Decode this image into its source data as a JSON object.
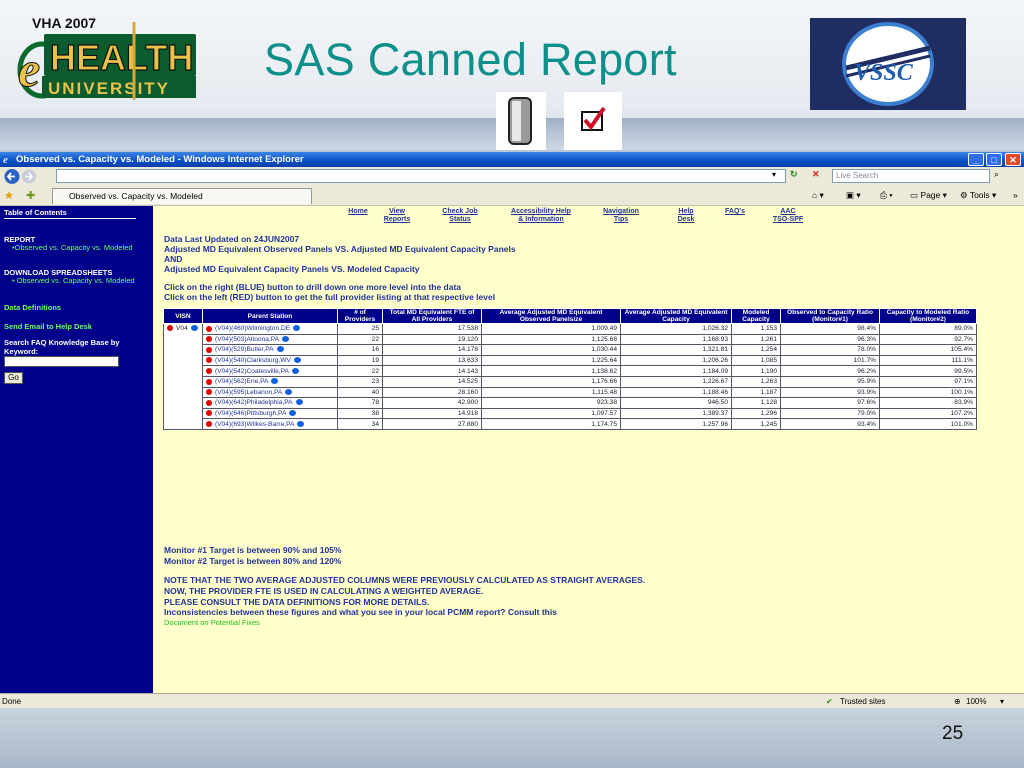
{
  "slide": {
    "title": "SAS Canned Report",
    "page_number": "25",
    "left_logo_text": "VHA 2007 eHEALTH UNIVERSITY",
    "right_logo_text": "VSSC"
  },
  "browser": {
    "window_title": "Observed vs. Capacity vs. Modeled - Windows Internet Explorer",
    "search_placeholder": "Live Search",
    "tab_label": "Observed vs. Capacity vs. Modeled",
    "toolbar": {
      "page": "Page",
      "tools": "Tools"
    },
    "status": {
      "left": "Done",
      "zone": "Trusted sites",
      "zoom": "100%"
    }
  },
  "sidebar": {
    "toc": "Table of Contents",
    "report": "REPORT",
    "report_link": "•Observed vs. Capacity vs. Modeled",
    "download": "DOWNLOAD SPREADSHEETS",
    "download_link": "• Observed vs. Capacity vs. Modeled",
    "data_definitions": "Data Definitions",
    "send_email": "Send Email to Help Desk",
    "search_label": "Search FAQ Knowledge Base by Keyword:",
    "go": "Go"
  },
  "nav": [
    {
      "line1": "",
      "line2": "Home"
    },
    {
      "line1": "View",
      "line2": "Reports"
    },
    {
      "line1": "Check Job",
      "line2": "Status"
    },
    {
      "line1": "Accessibility  Help",
      "line2": "& Information"
    },
    {
      "line1": "Navigation",
      "line2": "Tips"
    },
    {
      "line1": "Help",
      "line2": "Desk"
    },
    {
      "line1": "",
      "line2": "FAQ's"
    },
    {
      "line1": "AAC",
      "line2": "TSO-SPF"
    }
  ],
  "content": {
    "updated": "Data Last Updated on 24JUN2007",
    "line1": "Adjusted MD Equivalent Observed Panels VS. Adjusted MD Equivalent Capacity Panels",
    "line2": "AND",
    "line3": "Adjusted MD Equivalent Capacity Panels VS. Modeled Capacity",
    "click1": "Click on the right (BLUE) button to drill down one more level into the data",
    "click2": "Click on the left (RED) button to get the full provider listing at that respective level",
    "monitor1": "Monitor #1 Target is between 90% and 105%",
    "monitor2": "Monitor #2 Target is between 80% and 120%",
    "note1": "NOTE THAT THE TWO AVERAGE ADJUSTED COLUMNS WERE PREVIOUSLY CALCULATED AS STRAIGHT AVERAGES.",
    "note2": "NOW, THE PROVIDER FTE IS USED IN CALCULATING A WEIGHTED AVERAGE.",
    "note3": "PLEASE CONSULT THE DATA DEFINITIONS FOR MORE DETAILS.",
    "note4": "Inconsistencies between these figures and what you see in your local PCMM report? Consult this",
    "doc_link": "Document on Potential Fixes"
  },
  "table": {
    "headers": [
      "VISN",
      "Parent Station",
      "# of Providers",
      "Total MD Equivalent FTE of All Providers",
      "Average Adjusted MD Equivalent Observed Panelsize",
      "Average Adjusted MD Equivalent Capacity",
      "Modeled Capacity",
      "Observed to Capacity Ratio (Monitor#1)",
      "Capacity to Modeled Ratio (Monitor#2)"
    ],
    "visn": "V04",
    "rows": [
      {
        "station": "(V04)(460)Wilmington,DE",
        "providers": "25",
        "fte": "17.538",
        "observed": "1,009.49",
        "capacity": "1,026.32",
        "modeled": "1,153",
        "m1": "98.4%",
        "m1c": "grn",
        "m2": "89.0%",
        "m2c": "grn"
      },
      {
        "station": "(V04)(503)Altoona,PA",
        "providers": "22",
        "fte": "19.120",
        "observed": "1,125.68",
        "capacity": "1,168.93",
        "modeled": "1,261",
        "m1": "96.3%",
        "m1c": "grn",
        "m2": "92.7%",
        "m2c": "grn"
      },
      {
        "station": "(V04)(529)Butler,PA",
        "providers": "16",
        "fte": "14.178",
        "observed": "1,030.44",
        "capacity": "1,321.81",
        "modeled": "1,254",
        "m1": "78.0%",
        "m1c": "red",
        "m2": "105.4%",
        "m2c": "grn"
      },
      {
        "station": "(V04)(540)Clarksburg,WV",
        "providers": "19",
        "fte": "13.633",
        "observed": "1,225.64",
        "capacity": "1,206.26",
        "modeled": "1,085",
        "m1": "101.7%",
        "m1c": "grn",
        "m2": "111.1%",
        "m2c": "grn"
      },
      {
        "station": "(V04)(542)Coatesville,PA",
        "providers": "22",
        "fte": "14.143",
        "observed": "1,138.62",
        "capacity": "1,184.09",
        "modeled": "1,190",
        "m1": "96.2%",
        "m1c": "grn",
        "m2": "99.5%",
        "m2c": "grn"
      },
      {
        "station": "(V04)(562)Erie,PA",
        "providers": "23",
        "fte": "14.525",
        "observed": "1,176.66",
        "capacity": "1,226.67",
        "modeled": "1,263",
        "m1": "95.9%",
        "m1c": "grn",
        "m2": "97.1%",
        "m2c": "grn"
      },
      {
        "station": "(V04)(595)Lebanon,PA",
        "providers": "40",
        "fte": "28.160",
        "observed": "1,115.48",
        "capacity": "1,188.46",
        "modeled": "1,187",
        "m1": "93.9%",
        "m1c": "grn",
        "m2": "100.1%",
        "m2c": "grn"
      },
      {
        "station": "(V04)(642)Philadelphia,PA",
        "providers": "78",
        "fte": "42.900",
        "observed": "923.38",
        "capacity": "946.50",
        "modeled": "1,128",
        "m1": "97.6%",
        "m1c": "grn",
        "m2": "83.9%",
        "m2c": "grn"
      },
      {
        "station": "(V04)(646)Pittsburgh,PA",
        "providers": "38",
        "fte": "14.918",
        "observed": "1,097.57",
        "capacity": "1,389.37",
        "modeled": "1,296",
        "m1": "79.0%",
        "m1c": "red",
        "m2": "107.2%",
        "m2c": "grn"
      },
      {
        "station": "(V04)(693)Wilkes-Barre,PA",
        "providers": "34",
        "fte": "27.880",
        "observed": "1,174.75",
        "capacity": "1,257.96",
        "modeled": "1,245",
        "m1": "93.4%",
        "m1c": "grn",
        "m2": "101.0%",
        "m2c": "grn"
      }
    ]
  }
}
